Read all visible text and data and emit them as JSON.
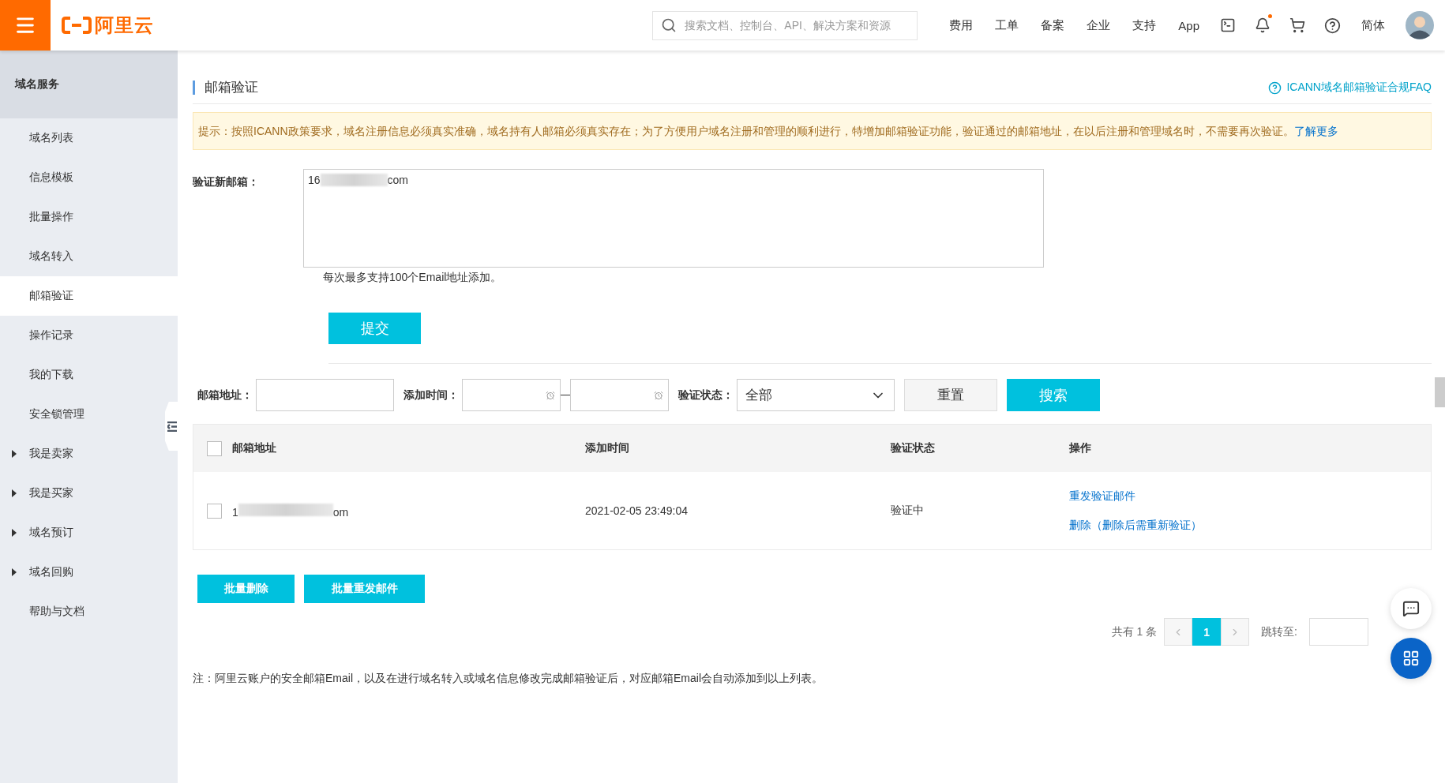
{
  "topbar": {
    "logo_text": "阿里云",
    "search_placeholder": "搜索文档、控制台、API、解决方案和资源",
    "nav_links": [
      "费用",
      "工单",
      "备案",
      "企业",
      "支持",
      "App"
    ],
    "notification_dot": true,
    "language": "简体"
  },
  "sidebar": {
    "title": "域名服务",
    "items": [
      {
        "label": "域名列表",
        "selected": false,
        "expandable": false
      },
      {
        "label": "信息模板",
        "selected": false,
        "expandable": false
      },
      {
        "label": "批量操作",
        "selected": false,
        "expandable": false
      },
      {
        "label": "域名转入",
        "selected": false,
        "expandable": false
      },
      {
        "label": "邮箱验证",
        "selected": true,
        "expandable": false
      },
      {
        "label": "操作记录",
        "selected": false,
        "expandable": false
      },
      {
        "label": "我的下载",
        "selected": false,
        "expandable": false
      },
      {
        "label": "安全锁管理",
        "selected": false,
        "expandable": false
      },
      {
        "label": "我是卖家",
        "selected": false,
        "expandable": true
      },
      {
        "label": "我是买家",
        "selected": false,
        "expandable": true
      },
      {
        "label": "域名预订",
        "selected": false,
        "expandable": true
      },
      {
        "label": "域名回购",
        "selected": false,
        "expandable": true
      },
      {
        "label": "帮助与文档",
        "selected": false,
        "expandable": false
      }
    ]
  },
  "page": {
    "title": "邮箱验证",
    "faq_link": "ICANN域名邮箱验证合规FAQ"
  },
  "notice": {
    "text": "提示：按照ICANN政策要求，域名注册信息必须真实准确，域名持有人邮箱必须真实存在；为了方便用户域名注册和管理的顺利进行，特增加邮箱验证功能，验证通过的邮箱地址，在以后注册和管理域名时，不需要再次验证。",
    "link": "了解更多"
  },
  "new_email_form": {
    "label": "验证新邮箱：",
    "value_start": "16",
    "value_end": "com",
    "hint": "每次最多支持100个Email地址添加。",
    "submit": "提交"
  },
  "filters": {
    "email_label": "邮箱地址：",
    "time_label": "添加时间：",
    "status_label": "验证状态：",
    "status_value": "全部",
    "reset": "重置",
    "search": "搜索"
  },
  "table": {
    "all_checked": false,
    "columns": [
      "邮箱地址",
      "添加时间",
      "验证状态",
      "操作"
    ],
    "rows": [
      {
        "checked": false,
        "email_start": "1",
        "email_end": "om",
        "added": "2021-02-05 23:49:04",
        "status": "验证中",
        "actions": [
          "重发验证邮件",
          "删除（删除后需重新验证）"
        ]
      }
    ]
  },
  "batch_buttons": [
    "批量删除",
    "批量重发邮件"
  ],
  "pagination": {
    "total": "共有 1 条",
    "pages": [
      {
        "label": "1",
        "selected": true
      }
    ],
    "jump_label": "跳转至:"
  },
  "footnote": "注：阿里云账户的安全邮箱Email，以及在进行域名转入或域名信息修改完成邮箱验证后，对应邮箱Email会自动添加到以上列表。"
}
